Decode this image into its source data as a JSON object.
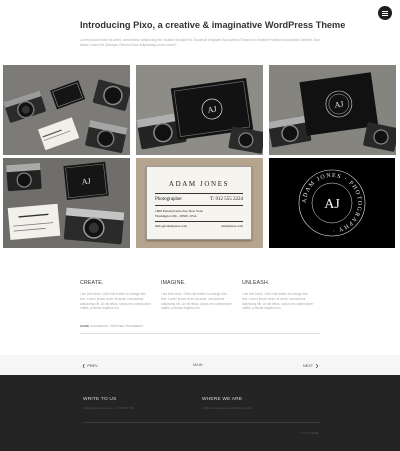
{
  "header": {
    "title": "Introducing Pixo, a creative & imaginative WordPress Theme",
    "intro": "Lorem ipsum dolor sit amet, consectetur adipiscing elit. Nullam Suscipit Ea Occaecat Magnam Accusamus Eiusmod a Nostra Proident Accusamus Deleniti. Non Atque Lorem Mi Quisque, Rerum Dolor Adipisicing Lorem Amet?"
  },
  "gallery": {
    "card": {
      "name": "ADAM JONES",
      "role": "Photographer",
      "phone": "T: 912 555 2224",
      "address_1": "1600 Pennsylvania Ave New York",
      "address_2": "Washington DC, 20500, USA",
      "email": "hello@adamjones.com",
      "site": "adamjones.com"
    },
    "logo": {
      "monogram": "AJ",
      "ring_text": "ADAM JONES · PHOTOGRAPHY ·"
    }
  },
  "features": [
    {
      "title": "CREATE.",
      "body": "I am text block. Click edit button to change this text. Lorem ipsum dolor sit amet, consectetur adipiscing elit. Ut elit tellus, luctus nec ullamcorper mattis, pulvinar dapibus leo."
    },
    {
      "title": "IMAGINE.",
      "body": "I am text block. Click edit button to change this text. Lorem ipsum dolor sit amet, consectetur adipiscing elit. Ut elit tellus, luctus nec ullamcorper mattis, pulvinar dapibus leo."
    },
    {
      "title": "UNLEASH.",
      "body": "I am text block. Click edit button to change this text. Lorem ipsum dolor sit amet, consectetur adipiscing elit. Ut elit tellus, luctus nec ullamcorper mattis, pulvinar dapibus leo."
    }
  ],
  "tags": {
    "home": "HOME",
    "rest": " / FACEBOOK / TWITTER / PINTEREST"
  },
  "pager": {
    "prev": "PREV",
    "main": "MAIN",
    "next": "NEXT"
  },
  "footer": {
    "write_title": "WRITE TO US",
    "write_text": "hello@pixo-theme.com · +1 234 567 890",
    "where_title": "WHERE WE ARE",
    "where_text": "1600 Pennsylvania Ave, Washington DC",
    "copyright": "© PIXO THEME"
  },
  "icons": {
    "menu": "hamburger-icon",
    "prev": "chevron-left-icon",
    "next": "chevron-right-icon"
  }
}
